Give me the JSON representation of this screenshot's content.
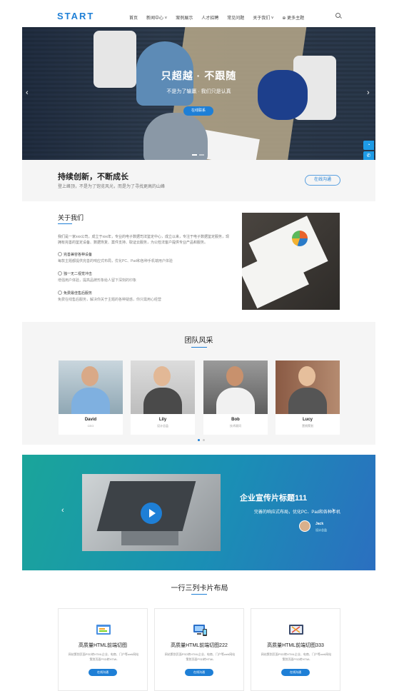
{
  "header": {
    "logo": "START",
    "nav": [
      "首页",
      "新闻中心 ˅",
      "案例展示",
      "人才招聘",
      "常见问题",
      "关于我们 ˅",
      "⊕ 更多主题"
    ]
  },
  "hero": {
    "title": "只超越 · 不跟随",
    "subtitle": "不是为了输赢 · 我们只是认真",
    "button": "在线联系",
    "prev": "‹",
    "next": "›"
  },
  "side_tools": [
    "◔",
    "✆",
    "☁"
  ],
  "slogan": {
    "title": "持续创新，不断成长",
    "text": "登上峰顶，不是为了饱览风光，而是为了寻找更高的山峰",
    "button": "在线沟通"
  },
  "about": {
    "title": "关于我们",
    "text": "我们是一家xxx公司，成立于xxx年，专业的电子数据司法鉴定中心，成立以来，专注于电子数据鉴定服务，现拥有完善的鉴定设备、数据恢复、案件支持、取证云服务，为公检法客户提供专业产品和服务。",
    "features": [
      {
        "title": "完善兼容各种设备",
        "desc": "每款主题都提供完善的响应式布局，优化PC、Pad和各种手机端用户体验"
      },
      {
        "title": "独一无二视觉冲击",
        "desc": "增强用户体验，提高品牌形象给人留下深刻的印象"
      },
      {
        "title": "免费最佳售后服务",
        "desc": "免费在线售后服务，解决你关于主题的各种疑惑，你只需用心经营"
      }
    ]
  },
  "team": {
    "title": "团队风采",
    "members": [
      {
        "name": "David",
        "role": "CEO"
      },
      {
        "name": "Lily",
        "role": "设计总监"
      },
      {
        "name": "Bob",
        "role": "技术顾问"
      },
      {
        "name": "Lucy",
        "role": "营销策划"
      }
    ]
  },
  "video": {
    "title": "企业宣传片标题111",
    "desc": "完善的响应式布局，优化PC、Pad和各种手机",
    "author": "Jack",
    "author_role": "设计总监",
    "prev": "‹",
    "next": "›"
  },
  "cards": {
    "title": "一行三列卡片布局",
    "items": [
      {
        "title": "高质量HTML前端切图",
        "desc": "网站策划页面PSD转HTML企业、电商、门户等web网站策划页面PSD转HTML",
        "button": "在线沟通"
      },
      {
        "title": "高质量HTML前端切图222",
        "desc": "网站策划页面PSD转HTML企业、电商、门户等web网站策划页面PSD转HTML",
        "button": "在线沟通"
      },
      {
        "title": "高质量HTML前端切图333",
        "desc": "网站策划页面PSD转HTML企业、电商、门户等web网站策划页面PSD转HTML",
        "button": "在线沟通"
      }
    ]
  },
  "colors": {
    "accent": "#1e7fd6",
    "band": "#f5f5f5"
  }
}
